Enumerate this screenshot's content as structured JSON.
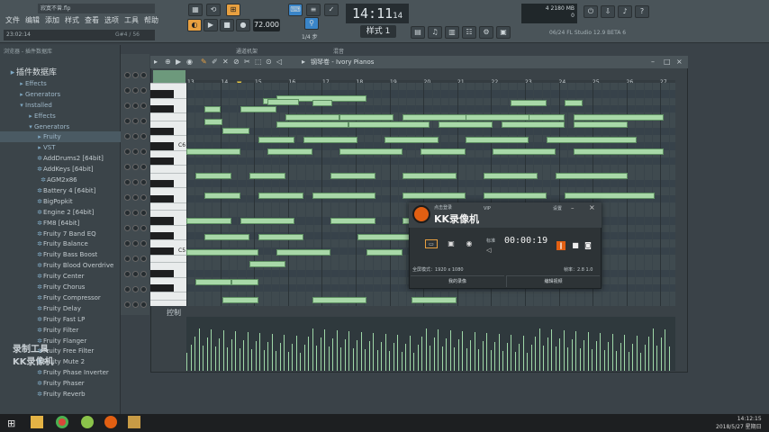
{
  "app": {
    "file_title": "寂寞不曾.flp",
    "menus": [
      "文件",
      "编辑",
      "添加",
      "样式",
      "查看",
      "选项",
      "工具",
      "帮助"
    ],
    "hint": "23:02:14",
    "hint_right": "G#4 / 56",
    "tempo": "72.000",
    "clock": "14:11",
    "clock_sec": "14",
    "pattern": "样式 1",
    "cpu_mem": "4   2180 MB",
    "cpu_val": "0",
    "version": "06/24  FL Studio 12.9 BETA 6",
    "zoom": "1/4 步"
  },
  "sidebar": {
    "header": "浏览器 - 插件数据库",
    "items": [
      {
        "label": "插件数据库",
        "kind": "title"
      },
      {
        "label": "Effects",
        "kind": "folder"
      },
      {
        "label": "Generators",
        "kind": "folder"
      },
      {
        "label": "Installed",
        "kind": "folder-open"
      },
      {
        "label": "Effects",
        "kind": "folder"
      },
      {
        "label": "Generators",
        "kind": "folder-open"
      },
      {
        "label": "Fruity",
        "kind": "folder"
      },
      {
        "label": "VST",
        "kind": "folder"
      },
      {
        "label": "AddDrums2 [64bit]",
        "kind": "plugin"
      },
      {
        "label": "AddKeys [64bit]",
        "kind": "plugin"
      },
      {
        "label": "AGM2x86",
        "kind": "plugin"
      },
      {
        "label": "Battery 4 [64bit]",
        "kind": "plugin"
      },
      {
        "label": "BigPopkit",
        "kind": "plugin"
      },
      {
        "label": "Engine 2 [64bit]",
        "kind": "plugin"
      },
      {
        "label": "FM8 [64bit]",
        "kind": "plugin"
      },
      {
        "label": "Fruity 7 Band EQ",
        "kind": "plugin"
      },
      {
        "label": "Fruity Balance",
        "kind": "plugin"
      },
      {
        "label": "Fruity Bass Boost",
        "kind": "plugin"
      },
      {
        "label": "Fruity Blood Overdrive",
        "kind": "plugin"
      },
      {
        "label": "Fruity Center",
        "kind": "plugin"
      },
      {
        "label": "Fruity Chorus",
        "kind": "plugin"
      },
      {
        "label": "Fruity Compressor",
        "kind": "plugin"
      },
      {
        "label": "Fruity Delay",
        "kind": "plugin"
      },
      {
        "label": "Fruity Fast LP",
        "kind": "plugin"
      },
      {
        "label": "Fruity Filter",
        "kind": "plugin"
      },
      {
        "label": "Fruity Flanger",
        "kind": "plugin"
      },
      {
        "label": "Fruity Free Filter",
        "kind": "plugin"
      },
      {
        "label": "Fruity Mute 2",
        "kind": "plugin"
      },
      {
        "label": "Fruity Phase Inverter",
        "kind": "plugin"
      },
      {
        "label": "Fruity Phaser",
        "kind": "plugin"
      },
      {
        "label": "Fruity Reverb",
        "kind": "plugin"
      }
    ]
  },
  "watermark": {
    "line1": "录制工具",
    "line2": "KK录像机"
  },
  "pianoroll": {
    "title": "钢琴卷 - Ivory Pianos",
    "bar_numbers": [
      "13",
      "14",
      "15",
      "16",
      "17",
      "18",
      "19",
      "20",
      "21",
      "22",
      "23",
      "24",
      "25",
      "26",
      "27"
    ],
    "key_labels": [
      "C6",
      "C5"
    ],
    "control_label": "控制",
    "channel_rack": "通道机架",
    "mixer": "混音"
  },
  "recorder": {
    "small": "点击登录",
    "vip": "VIP",
    "title": "KK录像机",
    "settings": "设置",
    "time_label": "标准",
    "time": "00:00:19",
    "mode": "全屏模式：1920 x 1080",
    "fps": "帧率：2.8 1.0",
    "btn_left": "我的录像",
    "btn_right": "编辑视频"
  },
  "taskbar": {
    "time": "14:12:15",
    "date": "2018/5/27 星期日"
  },
  "colors": {
    "note": "#a8d8a8",
    "accent": "#e8a040",
    "record": "#e25f12"
  }
}
